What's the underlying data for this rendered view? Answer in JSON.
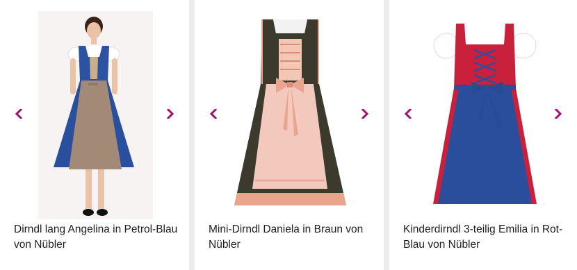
{
  "colors": {
    "arrow": "#a4106f",
    "title_text": "#1e1e1e",
    "card_background": "#ffffff",
    "gutter": "#ececec"
  },
  "icons": {
    "prev": "chevron-left-icon",
    "next": "chevron-right-icon"
  },
  "products": [
    {
      "title": "Dirndl lang Angelina in Petrol-Blau von Nübler",
      "image": "dirndl-angelina-photo"
    },
    {
      "title": "Mini-Dirndl Daniela in Braun von Nübler",
      "image": "dirndl-daniela-photo"
    },
    {
      "title": "Kinderdirndl 3-teilig Emilia in Rot-Blau von Nübler",
      "image": "dirndl-emilia-photo"
    }
  ]
}
